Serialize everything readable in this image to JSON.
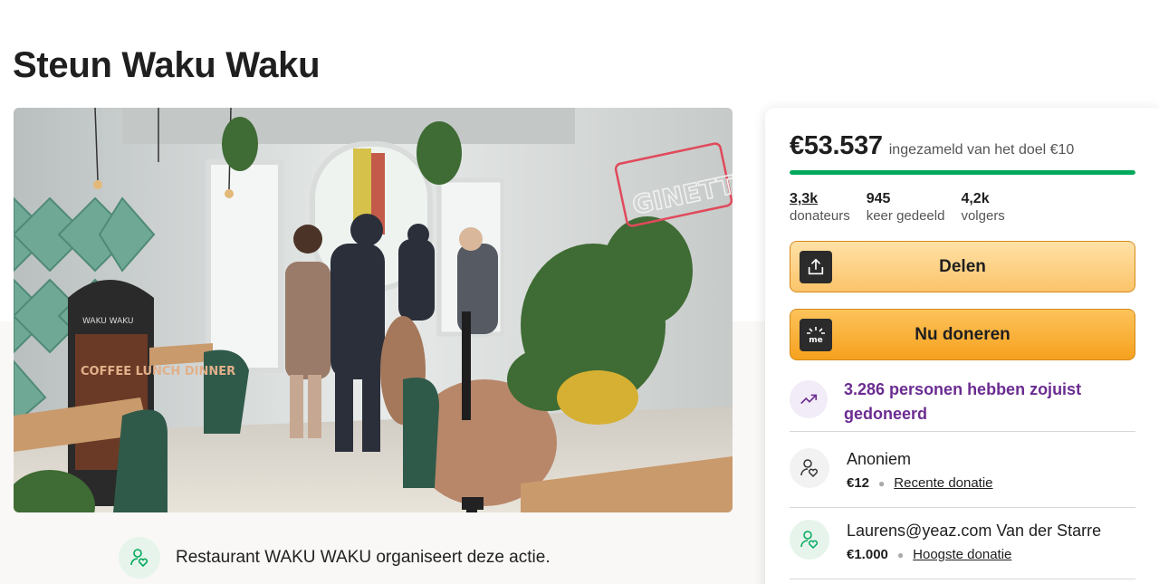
{
  "page": {
    "title": "Steun Waku Waku"
  },
  "hero": {
    "image_alt": "Interior of the restaurant with plants and guests",
    "neon_sign": "GINETTE",
    "signboard": "WAKU WAKU",
    "menu_board": "COFFEE LUNCH DINNER"
  },
  "organizer": {
    "text": "Restaurant WAKU WAKU organiseert deze actie.",
    "icon": "user-heart-icon"
  },
  "fundraiser": {
    "amount_raised": "€53.537",
    "goal_text": "ingezameld van het doel €10",
    "progress_fraction": 1.0,
    "progress_color": "#02a95c",
    "stats": [
      {
        "value": "3,3k",
        "label": "donateurs"
      },
      {
        "value": "945",
        "label": "keer gedeeld"
      },
      {
        "value": "4,2k",
        "label": "volgers"
      }
    ]
  },
  "buttons": {
    "share": {
      "label": "Delen",
      "icon": "share-upload-icon"
    },
    "donate": {
      "label": "Nu doneren",
      "icon": "gofundme-me-icon"
    }
  },
  "trend": {
    "text": "3.286 personen hebben zojuist gedoneerd",
    "icon": "trending-up-icon",
    "color": "#6b2c91"
  },
  "donations": [
    {
      "name": "Anoniem",
      "amount": "€12",
      "tag": "Recente donatie",
      "icon": "user-heart-icon"
    },
    {
      "name": "Laurens@yeaz.com Van der Starre",
      "amount": "€1.000",
      "tag": "Hoogste donatie",
      "icon": "user-heart-icon"
    }
  ]
}
